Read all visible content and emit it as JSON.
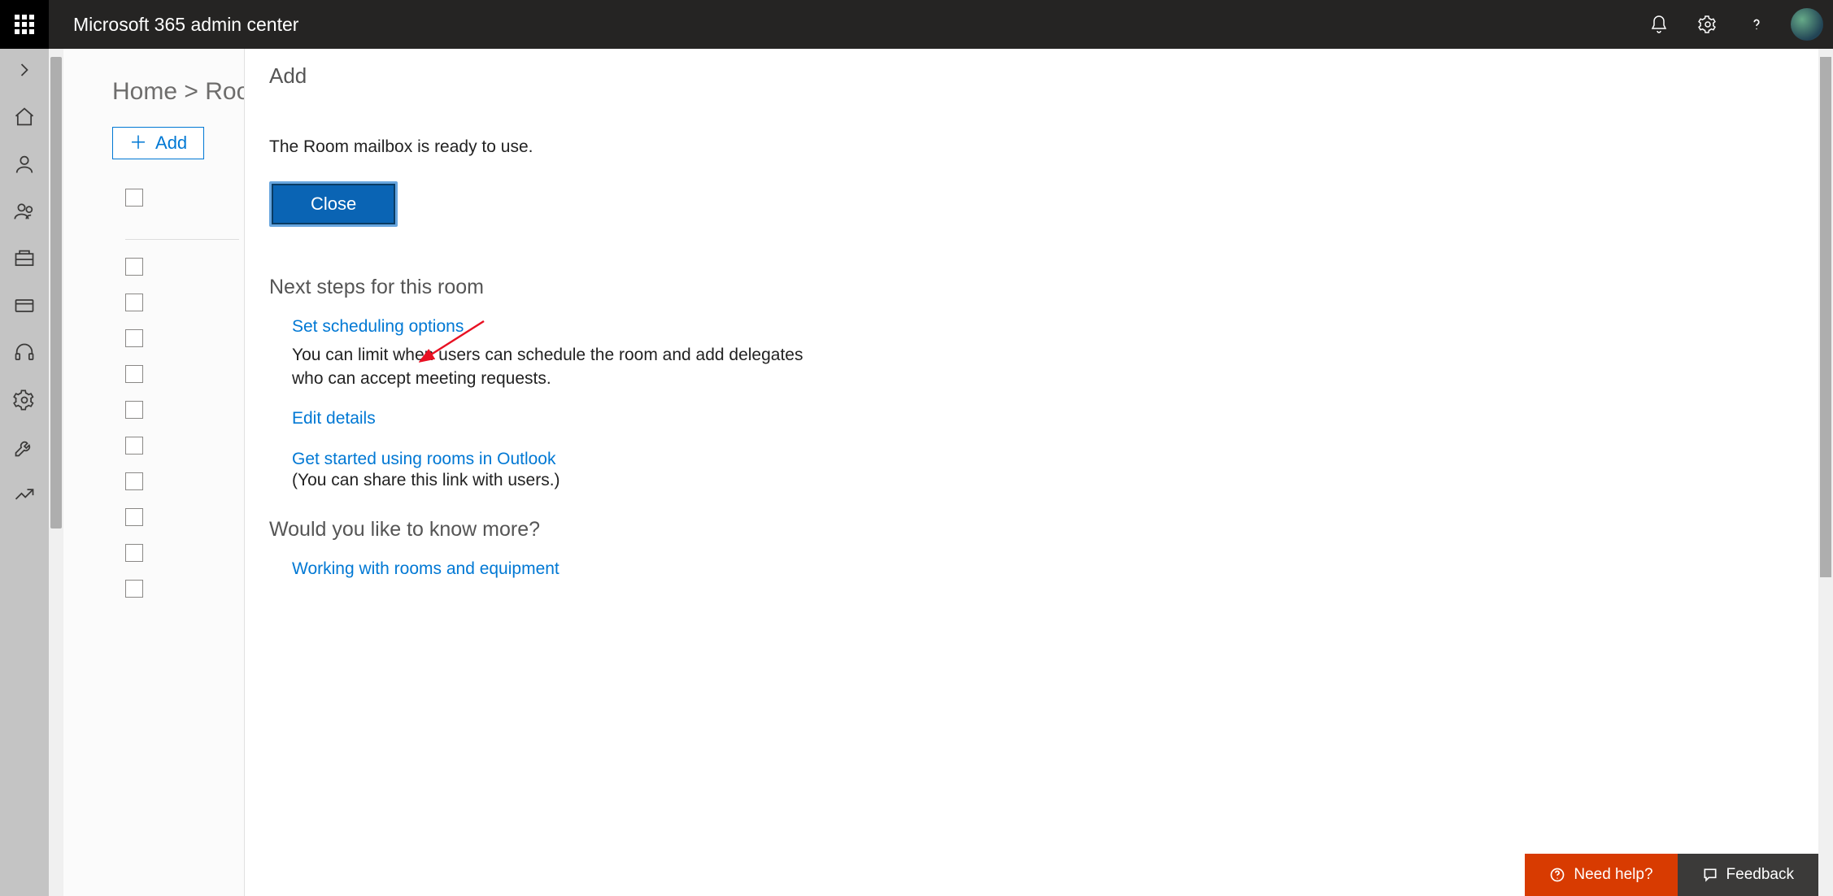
{
  "header": {
    "title": "Microsoft 365 admin center"
  },
  "breadcrumb": {
    "home": "Home",
    "separator": ">",
    "current": "Rooms &"
  },
  "toolbar": {
    "add_label": "Add"
  },
  "panel": {
    "title": "Add",
    "ready": "The Room mailbox is ready to use.",
    "close": "Close",
    "next_heading": "Next steps for this room",
    "link_scheduling": "Set scheduling options",
    "scheduling_desc": "You can limit when users can schedule the room and add delegates who can accept meeting requests.",
    "link_edit": "Edit details",
    "link_outlook": "Get started using rooms in Outlook",
    "outlook_note": "(You can share this link with users.)",
    "more_heading": "Would you like to know more?",
    "link_more": "Working with rooms and equipment"
  },
  "help": {
    "need": "Need help?",
    "feedback": "Feedback"
  }
}
